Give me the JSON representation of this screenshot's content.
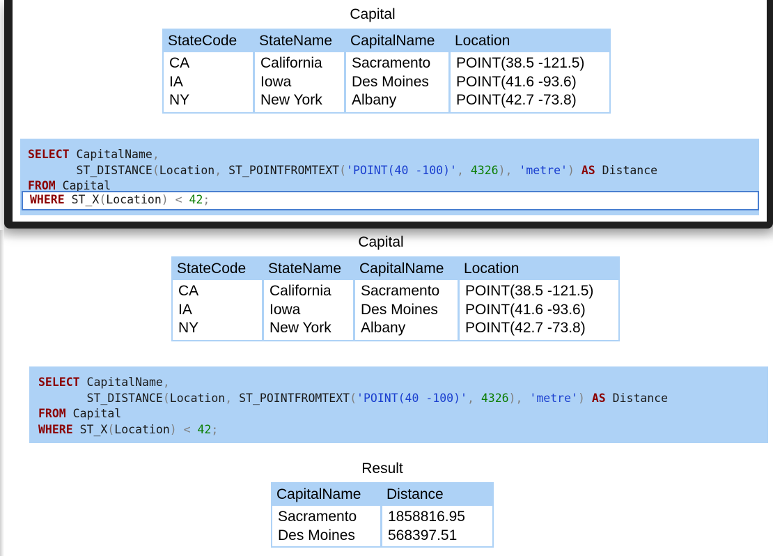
{
  "top_table": {
    "caption": "Capital",
    "headers": [
      "StateCode",
      "StateName",
      "CapitalName",
      "Location"
    ],
    "columns": [
      [
        "CA",
        "IA",
        "NY"
      ],
      [
        "California",
        "Iowa",
        "New York"
      ],
      [
        "Sacramento",
        "Des Moines",
        "Albany"
      ],
      [
        "POINT(38.5 -121.5)",
        "POINT(41.6 -93.6)",
        "POINT(42.7 -73.8)"
      ]
    ]
  },
  "query": {
    "select_kw": "SELECT",
    "select_field": " CapitalName",
    "comma": ",",
    "fn_distance": "ST_DISTANCE",
    "paren_open": "(",
    "location": "Location",
    "comma_space": ", ",
    "fn_pointfromtext": "ST_POINTFROMTEXT",
    "point_literal": "'POINT(40 -100)'",
    "srid": "4326",
    "paren_close": ")",
    "unit_literal": "'metre'",
    "as_kw": "AS",
    "alias": " Distance",
    "from_kw": "FROM",
    "table_name": " Capital",
    "where_kw": "WHERE",
    "fn_x": " ST_X",
    "lt": "<",
    "limit_value": "42",
    "semicolon": ";"
  },
  "result_table": {
    "caption": "Result",
    "headers": [
      "CapitalName",
      "Distance"
    ],
    "columns": [
      [
        "Sacramento",
        "Des Moines"
      ],
      [
        "1858816.95",
        "568397.51"
      ]
    ]
  }
}
